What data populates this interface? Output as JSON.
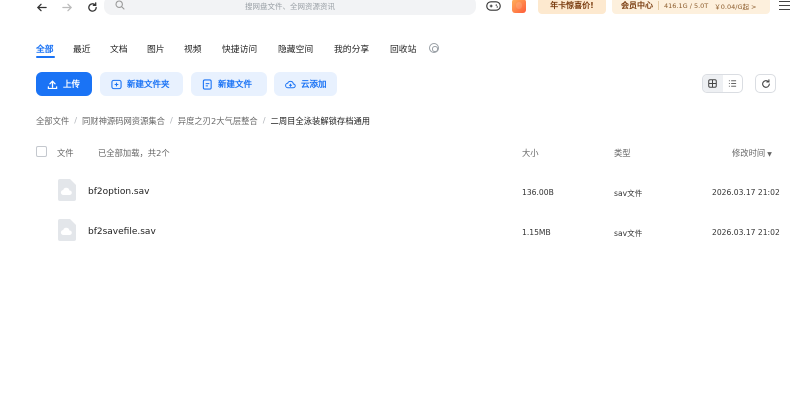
{
  "search": {
    "placeholder": "搜网盘文件、全网资源资讯"
  },
  "promo": {
    "label": "年卡惊喜价!"
  },
  "vip": {
    "label": "会员中心",
    "quota": "416.1G / 5.0T",
    "price": "￥0.04/G起 >"
  },
  "tabs": [
    {
      "label": "全部",
      "active": true
    },
    {
      "label": "最近"
    },
    {
      "label": "文档"
    },
    {
      "label": "图片"
    },
    {
      "label": "视频"
    },
    {
      "label": "快捷访问"
    },
    {
      "label": "隐藏空间"
    },
    {
      "label": "我的分享"
    },
    {
      "label": "回收站"
    }
  ],
  "actions": {
    "upload": "上传",
    "new_folder": "新建文件夹",
    "new_file": "新建文件",
    "cloud_add": "云添加"
  },
  "breadcrumb": [
    "全部文件",
    "同财神源码网资源集合",
    "异度之刃2大气层整合",
    "二周目全泳装解锁存档通用"
  ],
  "table": {
    "col_file": "文件",
    "status": "已全部加载，共2个",
    "col_size": "大小",
    "col_type": "类型",
    "col_modified": "修改时间",
    "rows": [
      {
        "name": "bf2option.sav",
        "size": "136.00B",
        "type": "sav文件",
        "modified": "2026.03.17 21:02"
      },
      {
        "name": "bf2savefile.sav",
        "size": "1.15MB",
        "type": "sav文件",
        "modified": "2026.03.17 21:02"
      }
    ]
  },
  "colors": {
    "accent": "#1a73f5",
    "accent_light": "#e8f1fe",
    "promo_bg": "#fde9cf",
    "file_icon": "#e3e6ea"
  },
  "icons": [
    "back-arrow-icon",
    "forward-arrow-icon",
    "refresh-icon",
    "search-icon",
    "gamepad-icon",
    "app-icon",
    "menu-icon",
    "settings-icon",
    "upload-icon",
    "folder-plus-icon",
    "file-plus-icon",
    "cloud-plus-icon",
    "grid-view-icon",
    "list-view-icon",
    "reload-icon",
    "cloud-file-icon"
  ]
}
